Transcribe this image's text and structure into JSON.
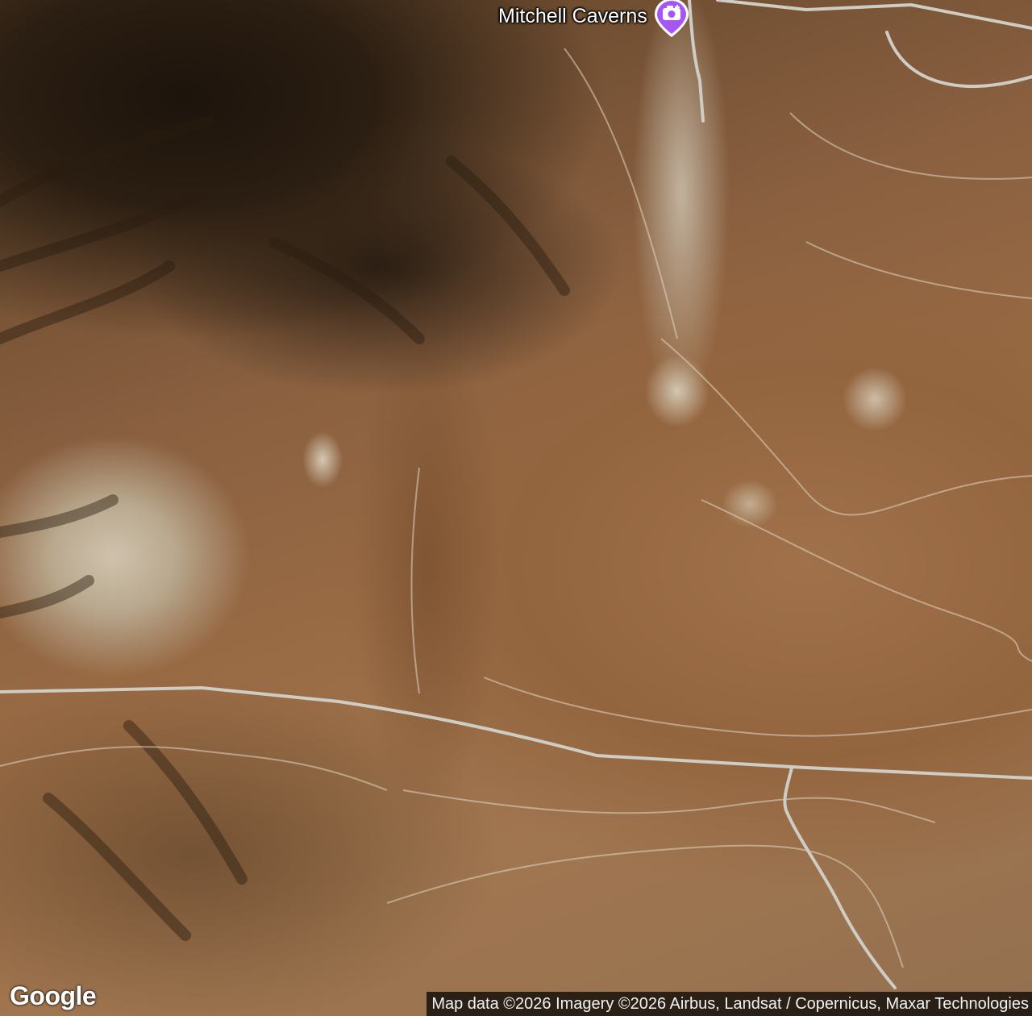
{
  "map": {
    "type": "satellite",
    "poi": {
      "name": "Mitchell Caverns",
      "icon": "camera-pin-icon",
      "pin_color": "#a855f7"
    },
    "logo": "Google",
    "attribution": "Map data ©2026 Imagery ©2026 Airbus, Landsat / Copernicus, Maxar Technologies",
    "road_color": "#c9c6bd"
  }
}
